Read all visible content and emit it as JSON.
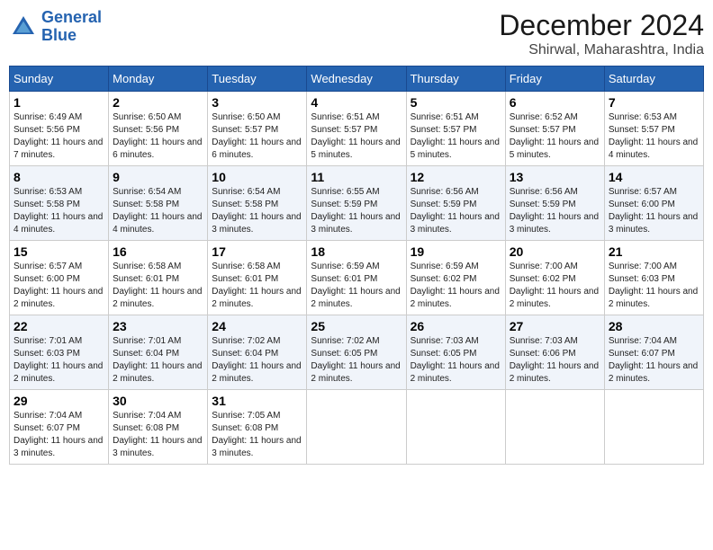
{
  "header": {
    "logo_line1": "General",
    "logo_line2": "Blue",
    "month": "December 2024",
    "location": "Shirwal, Maharashtra, India"
  },
  "weekdays": [
    "Sunday",
    "Monday",
    "Tuesday",
    "Wednesday",
    "Thursday",
    "Friday",
    "Saturday"
  ],
  "weeks": [
    [
      {
        "day": "1",
        "sunrise": "6:49 AM",
        "sunset": "5:56 PM",
        "daylight": "11 hours and 7 minutes."
      },
      {
        "day": "2",
        "sunrise": "6:50 AM",
        "sunset": "5:56 PM",
        "daylight": "11 hours and 6 minutes."
      },
      {
        "day": "3",
        "sunrise": "6:50 AM",
        "sunset": "5:57 PM",
        "daylight": "11 hours and 6 minutes."
      },
      {
        "day": "4",
        "sunrise": "6:51 AM",
        "sunset": "5:57 PM",
        "daylight": "11 hours and 5 minutes."
      },
      {
        "day": "5",
        "sunrise": "6:51 AM",
        "sunset": "5:57 PM",
        "daylight": "11 hours and 5 minutes."
      },
      {
        "day": "6",
        "sunrise": "6:52 AM",
        "sunset": "5:57 PM",
        "daylight": "11 hours and 5 minutes."
      },
      {
        "day": "7",
        "sunrise": "6:53 AM",
        "sunset": "5:57 PM",
        "daylight": "11 hours and 4 minutes."
      }
    ],
    [
      {
        "day": "8",
        "sunrise": "6:53 AM",
        "sunset": "5:58 PM",
        "daylight": "11 hours and 4 minutes."
      },
      {
        "day": "9",
        "sunrise": "6:54 AM",
        "sunset": "5:58 PM",
        "daylight": "11 hours and 4 minutes."
      },
      {
        "day": "10",
        "sunrise": "6:54 AM",
        "sunset": "5:58 PM",
        "daylight": "11 hours and 3 minutes."
      },
      {
        "day": "11",
        "sunrise": "6:55 AM",
        "sunset": "5:59 PM",
        "daylight": "11 hours and 3 minutes."
      },
      {
        "day": "12",
        "sunrise": "6:56 AM",
        "sunset": "5:59 PM",
        "daylight": "11 hours and 3 minutes."
      },
      {
        "day": "13",
        "sunrise": "6:56 AM",
        "sunset": "5:59 PM",
        "daylight": "11 hours and 3 minutes."
      },
      {
        "day": "14",
        "sunrise": "6:57 AM",
        "sunset": "6:00 PM",
        "daylight": "11 hours and 3 minutes."
      }
    ],
    [
      {
        "day": "15",
        "sunrise": "6:57 AM",
        "sunset": "6:00 PM",
        "daylight": "11 hours and 2 minutes."
      },
      {
        "day": "16",
        "sunrise": "6:58 AM",
        "sunset": "6:01 PM",
        "daylight": "11 hours and 2 minutes."
      },
      {
        "day": "17",
        "sunrise": "6:58 AM",
        "sunset": "6:01 PM",
        "daylight": "11 hours and 2 minutes."
      },
      {
        "day": "18",
        "sunrise": "6:59 AM",
        "sunset": "6:01 PM",
        "daylight": "11 hours and 2 minutes."
      },
      {
        "day": "19",
        "sunrise": "6:59 AM",
        "sunset": "6:02 PM",
        "daylight": "11 hours and 2 minutes."
      },
      {
        "day": "20",
        "sunrise": "7:00 AM",
        "sunset": "6:02 PM",
        "daylight": "11 hours and 2 minutes."
      },
      {
        "day": "21",
        "sunrise": "7:00 AM",
        "sunset": "6:03 PM",
        "daylight": "11 hours and 2 minutes."
      }
    ],
    [
      {
        "day": "22",
        "sunrise": "7:01 AM",
        "sunset": "6:03 PM",
        "daylight": "11 hours and 2 minutes."
      },
      {
        "day": "23",
        "sunrise": "7:01 AM",
        "sunset": "6:04 PM",
        "daylight": "11 hours and 2 minutes."
      },
      {
        "day": "24",
        "sunrise": "7:02 AM",
        "sunset": "6:04 PM",
        "daylight": "11 hours and 2 minutes."
      },
      {
        "day": "25",
        "sunrise": "7:02 AM",
        "sunset": "6:05 PM",
        "daylight": "11 hours and 2 minutes."
      },
      {
        "day": "26",
        "sunrise": "7:03 AM",
        "sunset": "6:05 PM",
        "daylight": "11 hours and 2 minutes."
      },
      {
        "day": "27",
        "sunrise": "7:03 AM",
        "sunset": "6:06 PM",
        "daylight": "11 hours and 2 minutes."
      },
      {
        "day": "28",
        "sunrise": "7:04 AM",
        "sunset": "6:07 PM",
        "daylight": "11 hours and 2 minutes."
      }
    ],
    [
      {
        "day": "29",
        "sunrise": "7:04 AM",
        "sunset": "6:07 PM",
        "daylight": "11 hours and 3 minutes."
      },
      {
        "day": "30",
        "sunrise": "7:04 AM",
        "sunset": "6:08 PM",
        "daylight": "11 hours and 3 minutes."
      },
      {
        "day": "31",
        "sunrise": "7:05 AM",
        "sunset": "6:08 PM",
        "daylight": "11 hours and 3 minutes."
      },
      null,
      null,
      null,
      null
    ]
  ]
}
